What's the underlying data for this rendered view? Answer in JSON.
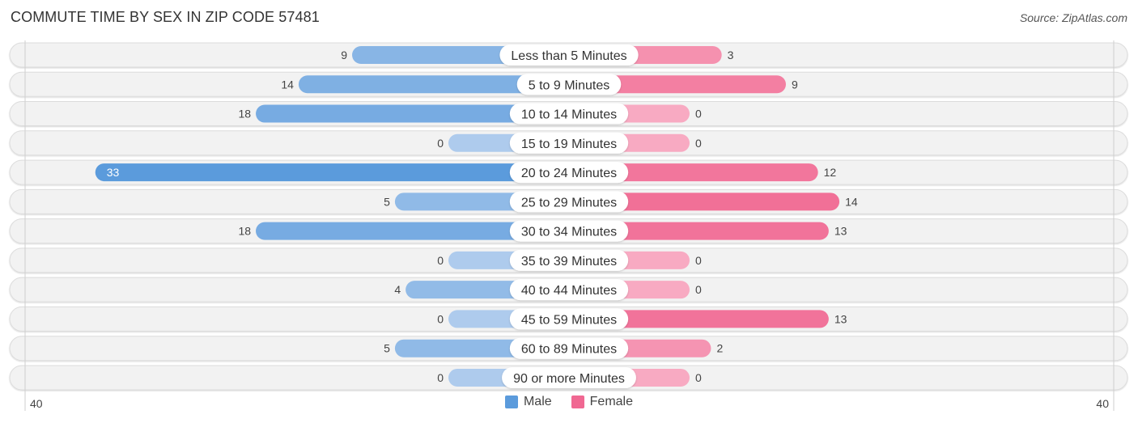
{
  "header": {
    "title": "COMMUTE TIME BY SEX IN ZIP CODE 57481",
    "source": "Source: ZipAtlas.com"
  },
  "legend": {
    "male_label": "Male",
    "female_label": "Female"
  },
  "colors": {
    "male_strong": "#5b9bdc",
    "male_light": "#aecbed",
    "female_strong": "#f06892",
    "female_light": "#f8aac2",
    "track": "#f2f2f2",
    "track_border": "#dcdcdc"
  },
  "chart_data": {
    "type": "bar",
    "orientation": "horizontal-diverging",
    "title": "COMMUTE TIME BY SEX IN ZIP CODE 57481",
    "categories": [
      "Less than 5 Minutes",
      "5 to 9 Minutes",
      "10 to 14 Minutes",
      "15 to 19 Minutes",
      "20 to 24 Minutes",
      "25 to 29 Minutes",
      "30 to 34 Minutes",
      "35 to 39 Minutes",
      "40 to 44 Minutes",
      "45 to 59 Minutes",
      "60 to 89 Minutes",
      "90 or more Minutes"
    ],
    "series": [
      {
        "name": "Male",
        "side": "left",
        "values": [
          9,
          14,
          18,
          0,
          33,
          5,
          18,
          0,
          4,
          0,
          5,
          0
        ]
      },
      {
        "name": "Female",
        "side": "right",
        "values": [
          3,
          9,
          0,
          0,
          12,
          14,
          13,
          0,
          0,
          13,
          2,
          0
        ]
      }
    ],
    "axis": {
      "left_label": "40",
      "right_label": "40",
      "range": [
        -40,
        40
      ]
    },
    "legend_position": "bottom-center",
    "grid": false
  }
}
